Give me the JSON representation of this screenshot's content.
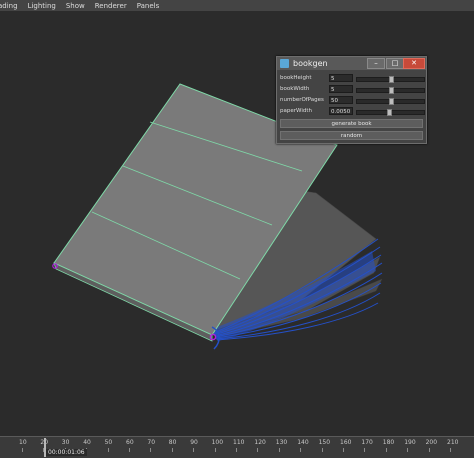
{
  "menu": {
    "items": [
      "ading",
      "Lighting",
      "Show",
      "Renderer",
      "Panels"
    ]
  },
  "window": {
    "title": "bookgen",
    "icon": "maya-window-icon",
    "minimize": "–",
    "maximize": "□",
    "close": "✕",
    "fields": [
      {
        "label": "bookHeight",
        "value": "5",
        "slider_fraction": 0.5
      },
      {
        "label": "bookWidth",
        "value": "5",
        "slider_fraction": 0.5
      },
      {
        "label": "numberOfPages",
        "value": "50",
        "slider_fraction": 0.5
      },
      {
        "label": "paperWidth",
        "value": "0.0050",
        "slider_fraction": 0.47
      }
    ],
    "buttons": {
      "generate": "generate book",
      "random": "random"
    }
  },
  "timeline": {
    "ticks": [
      "10",
      "20",
      "30",
      "40",
      "50",
      "60",
      "70",
      "80",
      "90",
      "100",
      "110",
      "120",
      "130",
      "140",
      "150",
      "160",
      "170",
      "180",
      "190",
      "200",
      "210"
    ],
    "timecode": "00:00:01:06"
  },
  "colors": {
    "wireframe": "#7fd9a8",
    "pages": "#2450c8",
    "background": "#2b2b2b"
  }
}
